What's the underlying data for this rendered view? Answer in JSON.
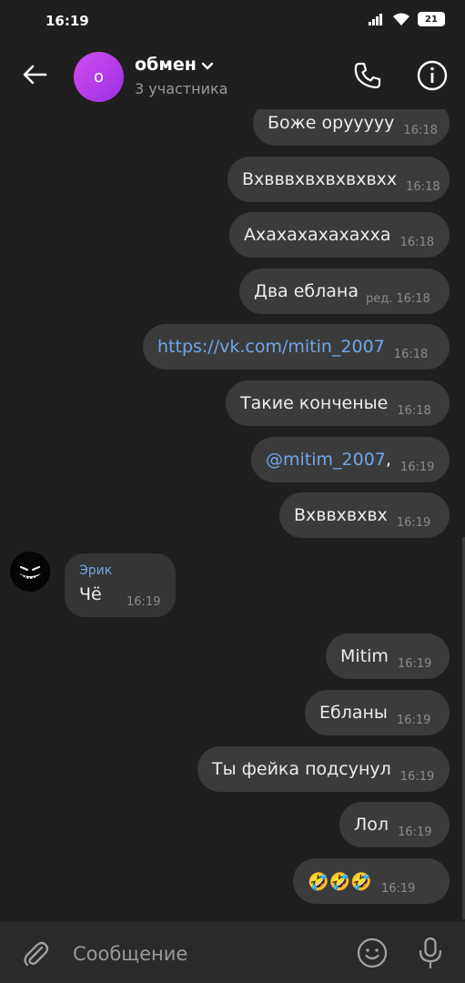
{
  "status_bar": {
    "time": "16:19",
    "battery": "21"
  },
  "header": {
    "avatar_letter": "о",
    "title": "обмен",
    "subtitle": "3 участника"
  },
  "messages": [
    {
      "text": "Боже оруууyy",
      "time": "16:18",
      "edited": ""
    },
    {
      "text": "Вхвввхвхвхвхвхх",
      "time": "16:18",
      "edited": ""
    },
    {
      "text": "Ахахахахахахха",
      "time": "16:18",
      "edited": ""
    },
    {
      "text": "Два еблана",
      "time": "16:18",
      "edited": "ред."
    },
    {
      "text": "https://vk.com/mitin_2007",
      "time": "16:18",
      "edited": ""
    },
    {
      "text": "Такие конченые",
      "time": "16:18",
      "edited": ""
    },
    {
      "text": "@mitim_2007",
      "suffix": ",",
      "time": "16:19",
      "edited": ""
    },
    {
      "text": "Вхввхвхвх",
      "time": "16:19",
      "edited": ""
    },
    {
      "text": "Mitim",
      "time": "16:19",
      "edited": ""
    },
    {
      "text": "Ебланы",
      "time": "16:19",
      "edited": ""
    },
    {
      "text": "Ты фейка подсунул",
      "time": "16:19",
      "edited": ""
    },
    {
      "text": "Лол",
      "time": "16:19",
      "edited": ""
    },
    {
      "text": "🤣🤣🤣",
      "time": "16:19",
      "edited": ""
    }
  ],
  "incoming": {
    "sender": "Эрик",
    "text": "Чё",
    "time": "16:19"
  },
  "composer": {
    "placeholder": "Сообщение"
  },
  "colors": {
    "accent": "#6fa7ea",
    "bubble": "#3b3b3b",
    "background": "#1f1f1f"
  }
}
